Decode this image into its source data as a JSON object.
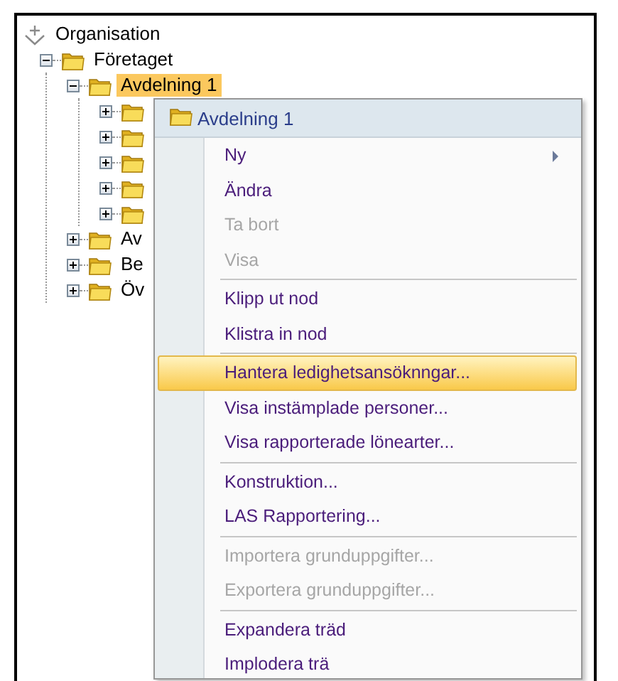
{
  "tree": {
    "root": {
      "label": "Organisation",
      "children": [
        {
          "label": "Företaget",
          "expanded": true,
          "selected": false,
          "children": [
            {
              "label": "Avdelning 1",
              "expanded": true,
              "selected": true,
              "children": [
                {
                  "expanded": false
                },
                {
                  "expanded": false
                },
                {
                  "expanded": false
                },
                {
                  "expanded": false
                },
                {
                  "expanded": false
                }
              ]
            },
            {
              "label": "Av",
              "expanded": false,
              "selected": false
            },
            {
              "label": "Be",
              "expanded": false,
              "selected": false
            },
            {
              "label": "Öv",
              "expanded": false,
              "selected": false
            }
          ]
        }
      ]
    }
  },
  "context_menu": {
    "header": {
      "label": "Avdelning 1"
    },
    "items": [
      {
        "kind": "item",
        "label": "Ny",
        "submenu": true,
        "disabled": false,
        "selected": false
      },
      {
        "kind": "item",
        "label": "Ändra",
        "disabled": false,
        "selected": false
      },
      {
        "kind": "item",
        "label": "Ta bort",
        "disabled": true,
        "selected": false
      },
      {
        "kind": "item",
        "label": "Visa",
        "disabled": true,
        "selected": false
      },
      {
        "kind": "separator"
      },
      {
        "kind": "item",
        "label": "Klipp ut nod",
        "disabled": false,
        "selected": false
      },
      {
        "kind": "item",
        "label": "Klistra in nod",
        "disabled": false,
        "selected": false
      },
      {
        "kind": "separator"
      },
      {
        "kind": "item",
        "label": "Hantera ledighetsansöknngar...",
        "disabled": false,
        "selected": true
      },
      {
        "kind": "item",
        "label": "Visa instämplade personer...",
        "disabled": false,
        "selected": false
      },
      {
        "kind": "item",
        "label": "Visa rapporterade lönearter...",
        "disabled": false,
        "selected": false
      },
      {
        "kind": "separator"
      },
      {
        "kind": "item",
        "label": "Konstruktion...",
        "disabled": false,
        "selected": false
      },
      {
        "kind": "item",
        "label": "LAS Rapportering...",
        "disabled": false,
        "selected": false
      },
      {
        "kind": "separator"
      },
      {
        "kind": "item",
        "label": "Importera grunduppgifter...",
        "disabled": true,
        "selected": false
      },
      {
        "kind": "item",
        "label": "Exportera grunduppgifter...",
        "disabled": true,
        "selected": false
      },
      {
        "kind": "separator"
      },
      {
        "kind": "item",
        "label": "Expandera träd",
        "disabled": false,
        "selected": false
      },
      {
        "kind": "item",
        "label": "Implodera trä",
        "disabled": false,
        "selected": false
      }
    ]
  }
}
